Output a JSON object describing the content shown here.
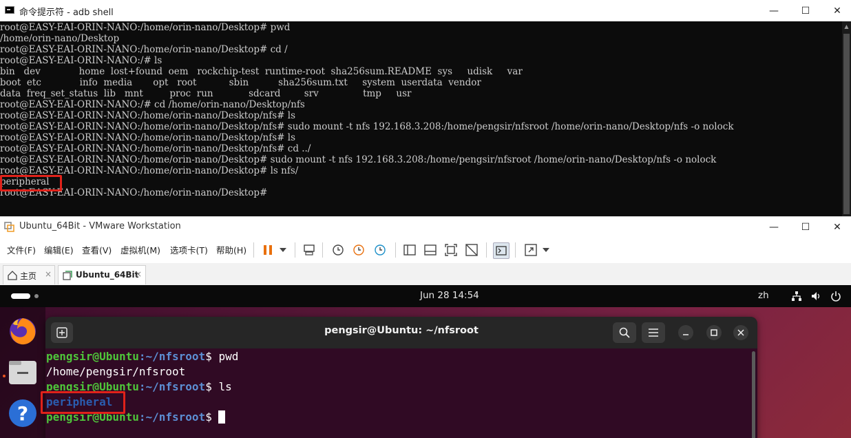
{
  "cmd": {
    "title": "命令提示符 - adb  shell",
    "lines": [
      "root@EASY-EAI-ORIN-NANO:/home/orin-nano/Desktop# pwd",
      "/home/orin-nano/Desktop",
      "root@EASY-EAI-ORIN-NANO:/home/orin-nano/Desktop# cd /",
      "root@EASY-EAI-ORIN-NANO:/# ls",
      "bin   dev             home  lost+found  oem   rockchip-test  runtime-root  sha256sum.README  sys     udisk     var",
      "boot  etc             info  media       opt   root           sbin          sha256sum.txt     system  userdata  vendor",
      "data  freq_set_status  lib   mnt         proc  run            sdcard        srv               tmp     usr",
      "root@EASY-EAI-ORIN-NANO:/# cd /home/orin-nano/Desktop/nfs",
      "root@EASY-EAI-ORIN-NANO:/home/orin-nano/Desktop/nfs# ls",
      "root@EASY-EAI-ORIN-NANO:/home/orin-nano/Desktop/nfs# sudo mount -t nfs 192.168.3.208:/home/pengsir/nfsroot /home/orin-nano/Desktop/nfs -o nolock",
      "root@EASY-EAI-ORIN-NANO:/home/orin-nano/Desktop/nfs# ls",
      "root@EASY-EAI-ORIN-NANO:/home/orin-nano/Desktop/nfs# cd ../",
      "root@EASY-EAI-ORIN-NANO:/home/orin-nano/Desktop# sudo mount -t nfs 192.168.3.208:/home/pengsir/nfsroot /home/orin-nano/Desktop/nfs -o nolock",
      "root@EASY-EAI-ORIN-NANO:/home/orin-nano/Desktop# ls nfs/",
      "peripheral",
      "root@EASY-EAI-ORIN-NANO:/home/orin-nano/Desktop#"
    ],
    "controls": {
      "minimize": "—",
      "maximize": "☐",
      "close": "✕"
    }
  },
  "vmware": {
    "title": "Ubuntu_64Bit - VMware Workstation",
    "controls": {
      "minimize": "—",
      "maximize": "☐",
      "close": "✕"
    },
    "menu": [
      "文件(F)",
      "编辑(E)",
      "查看(V)",
      "虚拟机(M)",
      "选项卡(T)",
      "帮助(H)"
    ],
    "tabs": [
      {
        "label": "主页",
        "icon": "home-icon",
        "close": "×"
      },
      {
        "label": "Ubuntu_64Bit",
        "icon": "vm-icon",
        "close": "×"
      }
    ],
    "toolbar_icons": [
      "pause-icon",
      "dropdown-arrow-icon",
      "send-ctrl-alt-del-icon",
      "snapshot-icon",
      "revert-snapshot-icon",
      "snapshot-manager-icon",
      "library-icon",
      "thumbnail-icon",
      "full-screen-icon",
      "unity-icon",
      "console-view-icon",
      "stretch-icon",
      "dropdown-arrow-icon"
    ],
    "accent_color": "#e9700d"
  },
  "ubuntu": {
    "clock": "Jun 28  14:54",
    "language": "zh",
    "tray_icons": [
      "network-icon",
      "volume-icon",
      "power-icon"
    ],
    "dock_icons": [
      "firefox-icon",
      "files-icon",
      "help-icon"
    ],
    "terminal": {
      "title": "pengsir@Ubuntu: ~/nfsroot",
      "prompt_user": "pengsir@Ubuntu",
      "prompt_path": ":~/nfsroot",
      "prompt_symbol": "$ ",
      "lines": [
        {
          "cmd": "pwd"
        },
        {
          "output": "/home/pengsir/nfsroot"
        },
        {
          "cmd": "ls"
        },
        {
          "output": "peripheral"
        },
        {
          "cmd": ""
        }
      ]
    }
  }
}
